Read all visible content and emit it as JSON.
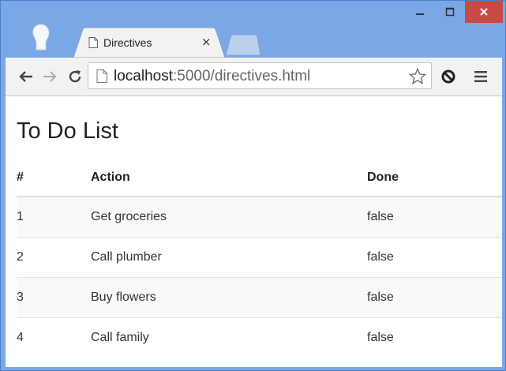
{
  "browser": {
    "tab_title": "Directives",
    "tab_close": "×",
    "url_host": "localhost",
    "url_rest": ":5000/directives.html"
  },
  "page": {
    "title": "To Do List",
    "table": {
      "headers": [
        "#",
        "Action",
        "Done"
      ],
      "rows": [
        [
          "1",
          "Get groceries",
          "false"
        ],
        [
          "2",
          "Call plumber",
          "false"
        ],
        [
          "3",
          "Buy flowers",
          "false"
        ],
        [
          "4",
          "Call family",
          "false"
        ]
      ]
    }
  },
  "colors": {
    "window_frame": "#7aa7e6",
    "close_button": "#c94a44"
  }
}
